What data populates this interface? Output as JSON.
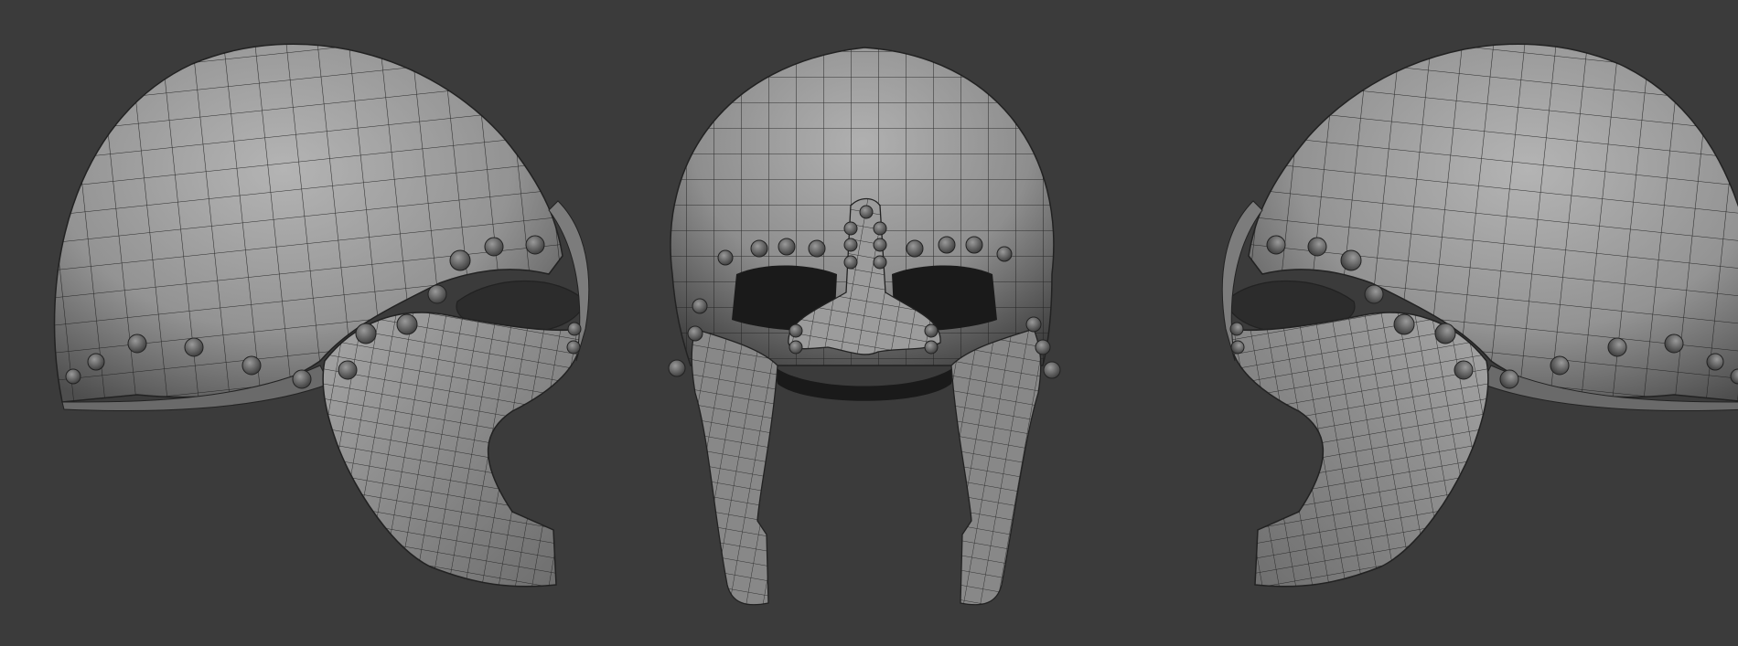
{
  "scene": {
    "background_color": "#3b3b3b",
    "surface_color": "#9a9a9a",
    "surface_shadow_color": "#4a4a4a",
    "wire_color": "#1e1e1e",
    "rivet_color": "#6f6f6f",
    "views": [
      {
        "name": "side-left",
        "object": "helmet",
        "shading": "wireframe-on-shaded"
      },
      {
        "name": "front",
        "object": "helmet",
        "shading": "wireframe-on-shaded"
      },
      {
        "name": "side-right",
        "object": "helmet",
        "shading": "wireframe-on-shaded"
      }
    ]
  }
}
